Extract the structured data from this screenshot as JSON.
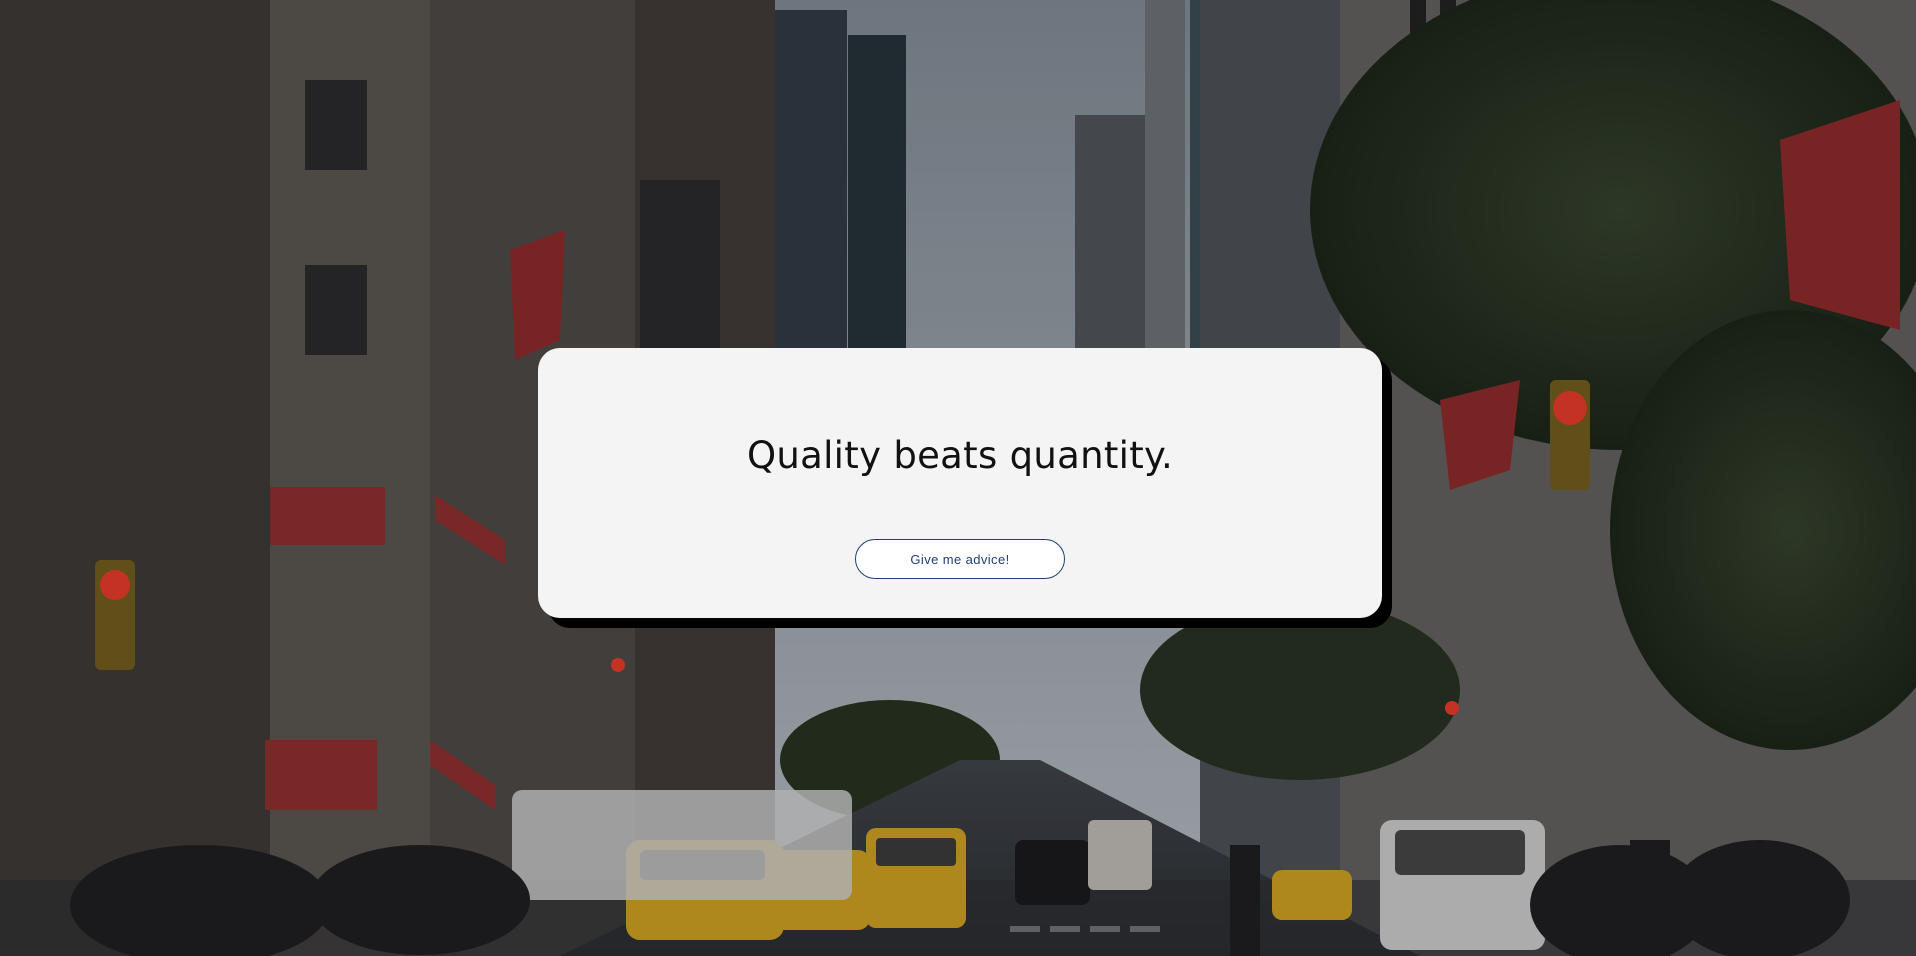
{
  "hero": {
    "background": "city-street-photo",
    "headline": "Quality beats quantity.",
    "cta_label": "Give me advice!"
  },
  "colors": {
    "card_bg": "#f4f4f4",
    "card_shadow": "#000000",
    "button_border": "#1e3f7a",
    "button_text": "#1e3f7a",
    "headline": "#111111"
  }
}
